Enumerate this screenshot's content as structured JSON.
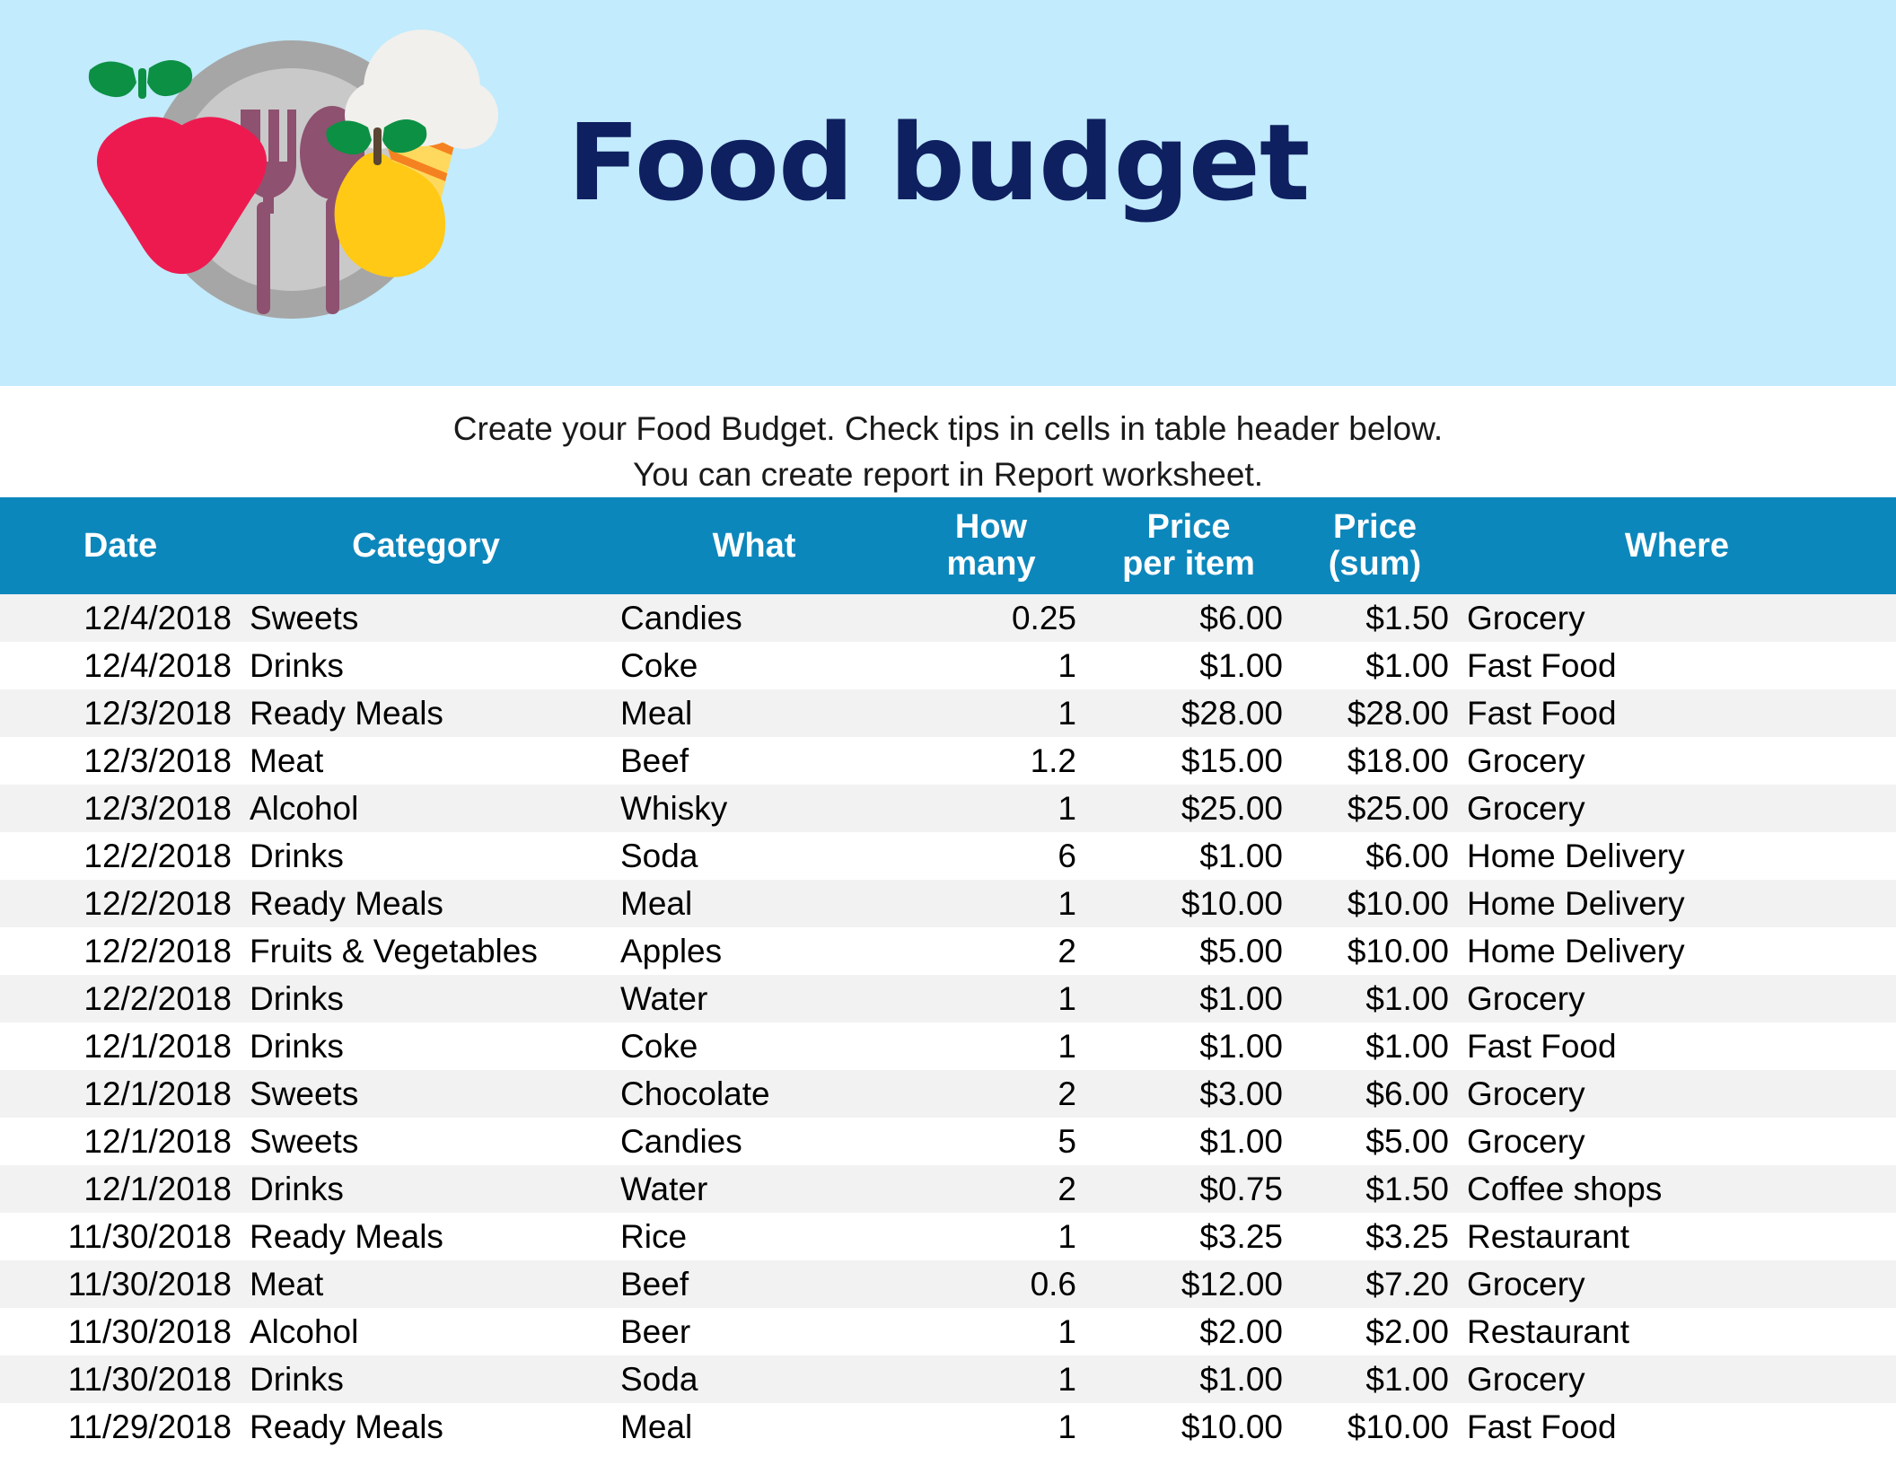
{
  "banner": {
    "title": "Food budget",
    "background_color": "#C2EBFD",
    "title_color": "#0F2060",
    "art_items": [
      "apple-illustration",
      "plate-illustration",
      "fork-illustration",
      "spoon-illustration",
      "ice-cream-cone-illustration",
      "pear-illustration"
    ]
  },
  "intro": {
    "line1": "Create your Food Budget. Check tips in cells in table header below.",
    "line2": "You can create report in Report worksheet."
  },
  "table": {
    "header_color": "#0C87BC",
    "stripe_color": "#F2F2F2",
    "columns": [
      {
        "key": "date",
        "label": "Date",
        "label2": ""
      },
      {
        "key": "category",
        "label": "Category",
        "label2": ""
      },
      {
        "key": "what",
        "label": "What",
        "label2": ""
      },
      {
        "key": "howmany",
        "label": "How",
        "label2": "many"
      },
      {
        "key": "priceper",
        "label": "Price",
        "label2": "per item"
      },
      {
        "key": "pricesum",
        "label": "Price",
        "label2": "(sum)"
      },
      {
        "key": "where",
        "label": "Where",
        "label2": ""
      }
    ],
    "rows": [
      {
        "date": "12/4/2018",
        "category": "Sweets",
        "what": "Candies",
        "howmany": "0.25",
        "priceper": "$6.00",
        "pricesum": "$1.50",
        "where": "Grocery"
      },
      {
        "date": "12/4/2018",
        "category": "Drinks",
        "what": "Coke",
        "howmany": "1",
        "priceper": "$1.00",
        "pricesum": "$1.00",
        "where": "Fast Food"
      },
      {
        "date": "12/3/2018",
        "category": "Ready Meals",
        "what": "Meal",
        "howmany": "1",
        "priceper": "$28.00",
        "pricesum": "$28.00",
        "where": "Fast Food"
      },
      {
        "date": "12/3/2018",
        "category": "Meat",
        "what": "Beef",
        "howmany": "1.2",
        "priceper": "$15.00",
        "pricesum": "$18.00",
        "where": "Grocery"
      },
      {
        "date": "12/3/2018",
        "category": "Alcohol",
        "what": "Whisky",
        "howmany": "1",
        "priceper": "$25.00",
        "pricesum": "$25.00",
        "where": "Grocery"
      },
      {
        "date": "12/2/2018",
        "category": "Drinks",
        "what": "Soda",
        "howmany": "6",
        "priceper": "$1.00",
        "pricesum": "$6.00",
        "where": "Home Delivery"
      },
      {
        "date": "12/2/2018",
        "category": "Ready Meals",
        "what": "Meal",
        "howmany": "1",
        "priceper": "$10.00",
        "pricesum": "$10.00",
        "where": "Home Delivery"
      },
      {
        "date": "12/2/2018",
        "category": "Fruits & Vegetables",
        "what": "Apples",
        "howmany": "2",
        "priceper": "$5.00",
        "pricesum": "$10.00",
        "where": "Home Delivery"
      },
      {
        "date": "12/2/2018",
        "category": "Drinks",
        "what": "Water",
        "howmany": "1",
        "priceper": "$1.00",
        "pricesum": "$1.00",
        "where": "Grocery"
      },
      {
        "date": "12/1/2018",
        "category": "Drinks",
        "what": "Coke",
        "howmany": "1",
        "priceper": "$1.00",
        "pricesum": "$1.00",
        "where": "Fast Food"
      },
      {
        "date": "12/1/2018",
        "category": "Sweets",
        "what": "Chocolate",
        "howmany": "2",
        "priceper": "$3.00",
        "pricesum": "$6.00",
        "where": "Grocery"
      },
      {
        "date": "12/1/2018",
        "category": "Sweets",
        "what": "Candies",
        "howmany": "5",
        "priceper": "$1.00",
        "pricesum": "$5.00",
        "where": "Grocery"
      },
      {
        "date": "12/1/2018",
        "category": "Drinks",
        "what": "Water",
        "howmany": "2",
        "priceper": "$0.75",
        "pricesum": "$1.50",
        "where": "Coffee shops"
      },
      {
        "date": "11/30/2018",
        "category": "Ready Meals",
        "what": "Rice",
        "howmany": "1",
        "priceper": "$3.25",
        "pricesum": "$3.25",
        "where": "Restaurant"
      },
      {
        "date": "11/30/2018",
        "category": "Meat",
        "what": "Beef",
        "howmany": "0.6",
        "priceper": "$12.00",
        "pricesum": "$7.20",
        "where": "Grocery"
      },
      {
        "date": "11/30/2018",
        "category": "Alcohol",
        "what": "Beer",
        "howmany": "1",
        "priceper": "$2.00",
        "pricesum": "$2.00",
        "where": "Restaurant"
      },
      {
        "date": "11/30/2018",
        "category": "Drinks",
        "what": "Soda",
        "howmany": "1",
        "priceper": "$1.00",
        "pricesum": "$1.00",
        "where": "Grocery"
      },
      {
        "date": "11/29/2018",
        "category": "Ready Meals",
        "what": "Meal",
        "howmany": "1",
        "priceper": "$10.00",
        "pricesum": "$10.00",
        "where": "Fast Food"
      }
    ]
  }
}
